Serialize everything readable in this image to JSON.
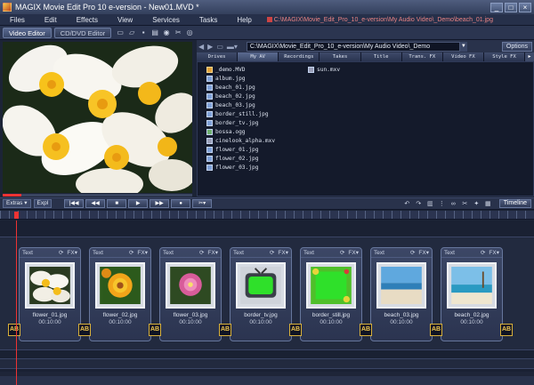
{
  "window": {
    "title": "MAGIX Movie Edit Pro 10 e-version - New01.MVD *",
    "buttons": [
      "_",
      "□",
      "×"
    ]
  },
  "menu": {
    "items": [
      "Files",
      "Edit",
      "Effects",
      "View",
      "Services",
      "Tasks",
      "Help"
    ],
    "path": "C:\\MAGIX\\Movie_Edit_Pro_10_e-version\\My Audio Video\\_Demo\\beach_01.jpg"
  },
  "toolbar": {
    "video_editor": "Video Editor",
    "cd_dvd_editor": "CD/DVD Editor"
  },
  "browser": {
    "path": "C:\\MAGIX\\Movie_Edit_Pro_10_e-version\\My Audio Video\\_Demo",
    "options": "Options",
    "tabs": [
      "Drives",
      "My AV",
      "Recordings",
      "Takes",
      "Title",
      "Trans. FX",
      "Video FX",
      "Style FX"
    ],
    "files": [
      {
        "name": "_demo.MVD",
        "kind": "mvd"
      },
      {
        "name": "album.jpg",
        "kind": "jpg"
      },
      {
        "name": "beach_01.jpg",
        "kind": "jpg"
      },
      {
        "name": "beach_02.jpg",
        "kind": "jpg"
      },
      {
        "name": "beach_03.jpg",
        "kind": "jpg"
      },
      {
        "name": "border_still.jpg",
        "kind": "jpg"
      },
      {
        "name": "border_tv.jpg",
        "kind": "jpg"
      },
      {
        "name": "bossa.ogg",
        "kind": "ogg"
      },
      {
        "name": "cinelook_alpha.mxv",
        "kind": "mxv"
      },
      {
        "name": "flower_01.jpg",
        "kind": "jpg"
      },
      {
        "name": "flower_02.jpg",
        "kind": "jpg"
      },
      {
        "name": "flower_03.jpg",
        "kind": "jpg"
      },
      {
        "name": "sun.mxv",
        "kind": "mxv"
      }
    ]
  },
  "preview": {
    "progress": 0.1
  },
  "controls": {
    "extras": "Extras ▾",
    "expl": "Expl",
    "timeline": "Timeline",
    "transport": [
      "|◀◀",
      "◀◀",
      "■",
      "▶",
      "▶▶",
      "●"
    ]
  },
  "timeline": {
    "clip_header_text": "Text",
    "clip_header_fx": "FX",
    "ab_label": "AB",
    "clips": [
      {
        "name": "flower_01.jpg",
        "time": "00:10:00"
      },
      {
        "name": "flower_02.jpg",
        "time": "00:10:00"
      },
      {
        "name": "flower_03.jpg",
        "time": "00:10:00"
      },
      {
        "name": "border_tv.jpg",
        "time": "00:10:00"
      },
      {
        "name": "border_still.jpg",
        "time": "00:10:00"
      },
      {
        "name": "beach_03.jpg",
        "time": "00:10:00"
      },
      {
        "name": "beach_02.jpg",
        "time": "00:10:00"
      }
    ]
  },
  "colors": {
    "accent_red": "#e33333",
    "ab_gold": "#f2c64e",
    "bg": "#1c2436"
  }
}
